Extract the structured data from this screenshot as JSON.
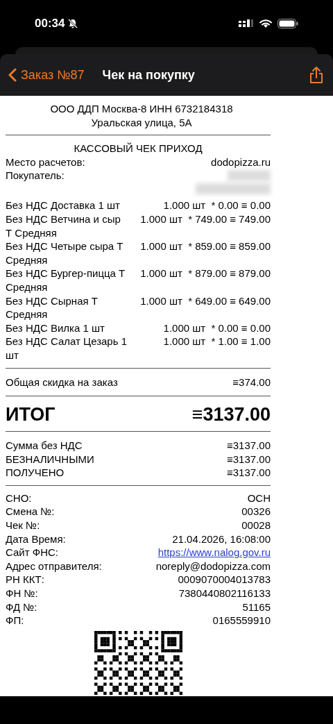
{
  "status_bar": {
    "time": "00:34"
  },
  "nav": {
    "back": "Заказ №87",
    "title": "Чек на покупку"
  },
  "receipt": {
    "header": [
      "ООО ДДП Москва-8 ИНН 6732184318",
      "Уральская улица, 5А"
    ],
    "type": "КАССОВЫЙ ЧЕК ПРИХОД",
    "place": {
      "label": "Место расчетов:",
      "value": "dodopizza.ru"
    },
    "buyer": {
      "label": "Покупатель:"
    },
    "items": [
      {
        "name": "Без НДС Доставка 1 шт",
        "amount": "1.000 шт  * 0.00 ≡ 0.00"
      },
      {
        "name": "Без НДС Ветчина и сыр Т Средняя",
        "amount": "1.000 шт  * 749.00 ≡ 749.00"
      },
      {
        "name": "Без НДС Четыре сыра Т Средняя",
        "amount": "1.000 шт  * 859.00 ≡ 859.00"
      },
      {
        "name": "Без НДС Бургер-пицца Т Средняя",
        "amount": "1.000 шт  * 879.00 ≡ 879.00"
      },
      {
        "name": "Без НДС Сырная Т Средняя",
        "amount": "1.000 шт  * 649.00 ≡ 649.00"
      },
      {
        "name": "Без НДС Вилка 1 шт",
        "amount": "1.000 шт  * 0.00 ≡ 0.00"
      },
      {
        "name": "Без НДС Салат Цезарь 1 шт",
        "amount": "1.000 шт  * 1.00 ≡ 1.00"
      }
    ],
    "discount": {
      "label": "Общая скидка на заказ",
      "value": "≡374.00"
    },
    "total": {
      "label": "ИТОГ",
      "value": "≡3137.00"
    },
    "payments": [
      {
        "label": "Сумма без НДС",
        "value": "≡3137.00"
      },
      {
        "label": "БЕЗНАЛИЧНЫМИ",
        "value": "≡3137.00"
      },
      {
        "label": "ПОЛУЧЕНО",
        "value": "≡3137.00"
      }
    ],
    "details": [
      {
        "label": "СНО:",
        "value": "ОСН",
        "kind": "text"
      },
      {
        "label": "Смена №:",
        "value": "00326",
        "kind": "text"
      },
      {
        "label": "Чек №:",
        "value": "00028",
        "kind": "text"
      },
      {
        "label": "Дата Время:",
        "value": "21.04.2026, 16:08:00",
        "kind": "text"
      },
      {
        "label": "Сайт ФНС:",
        "value": "https://www.nalog.gov.ru",
        "kind": "link"
      },
      {
        "label": "Адрес отправителя:",
        "value": "noreply@dodopizza.com",
        "kind": "text"
      },
      {
        "label": "РН ККТ:",
        "value": "0009070004013783",
        "kind": "text"
      },
      {
        "label": "ФН №:",
        "value": "7380440802116133",
        "kind": "text"
      },
      {
        "label": "ФД №:",
        "value": "51165",
        "kind": "text"
      },
      {
        "label": "ФП:",
        "value": "0165559910",
        "kind": "text"
      }
    ]
  }
}
